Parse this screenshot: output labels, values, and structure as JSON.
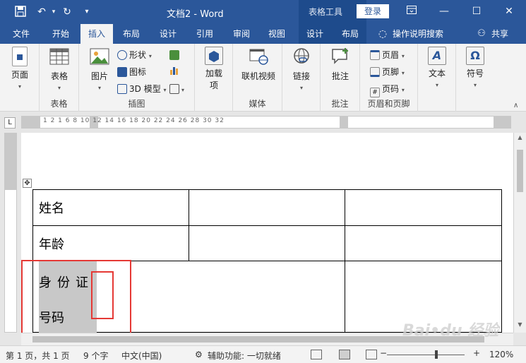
{
  "title_bar": {
    "title": "文档2  -  Word",
    "context_group": "表格工具",
    "login": "登录",
    "icons": [
      "save-icon",
      "undo-icon",
      "redo-icon",
      "customize-qat-icon",
      "ribbon-display-icon",
      "minimize-icon",
      "maximize-icon",
      "close-icon"
    ]
  },
  "tabs": [
    {
      "label": "文件"
    },
    {
      "label": "开始"
    },
    {
      "label": "插入",
      "active": true
    },
    {
      "label": "布局"
    },
    {
      "label": "设计"
    },
    {
      "label": "引用"
    },
    {
      "label": "审阅"
    },
    {
      "label": "视图"
    },
    {
      "label": "设计"
    },
    {
      "label": "布局"
    },
    {
      "label": "操作说明搜索"
    },
    {
      "label": "共享"
    }
  ],
  "ribbon": {
    "pages": {
      "btn": "页面",
      "group": ""
    },
    "tables": {
      "btn": "表格",
      "group": "表格"
    },
    "illustrations": {
      "group": "插图",
      "picture": "图片",
      "shapes": "形状",
      "icons": "图标",
      "model3d": "3D 模型"
    },
    "addins": {
      "btn": "加载\n项"
    },
    "media": {
      "btn": "联机视频",
      "group": "媒体"
    },
    "links": {
      "btn": "链接"
    },
    "comments": {
      "btn": "批注",
      "group": "批注"
    },
    "header_footer": {
      "group": "页眉和页脚",
      "header": "页眉",
      "footer": "页脚",
      "page_number": "页码"
    },
    "text": {
      "btn": "文本"
    },
    "symbols": {
      "btn": "符号"
    }
  },
  "ruler": {
    "ticks": "1   2   1       6   8   10   12   14   16   18   20   22       24   26   28   30   32"
  },
  "table": {
    "rows": [
      {
        "c1": "姓名",
        "c2": "",
        "c3": ""
      },
      {
        "c1": "年龄",
        "c2": "",
        "c3": ""
      }
    ],
    "id_line1": "身份证",
    "id_line2": "号码"
  },
  "statusbar": {
    "page": "第 1 页，共 1 页",
    "words": "9 个字",
    "language": "中文(中国)",
    "accessibility": "辅助功能: 一切就绪",
    "zoom": "120%",
    "zoom_level": 0.6
  },
  "colors": {
    "accent": "#2b579a",
    "context_tab": "#1e4b8c",
    "highlight_box": "#e53935",
    "selection": "#c8c8c8"
  }
}
